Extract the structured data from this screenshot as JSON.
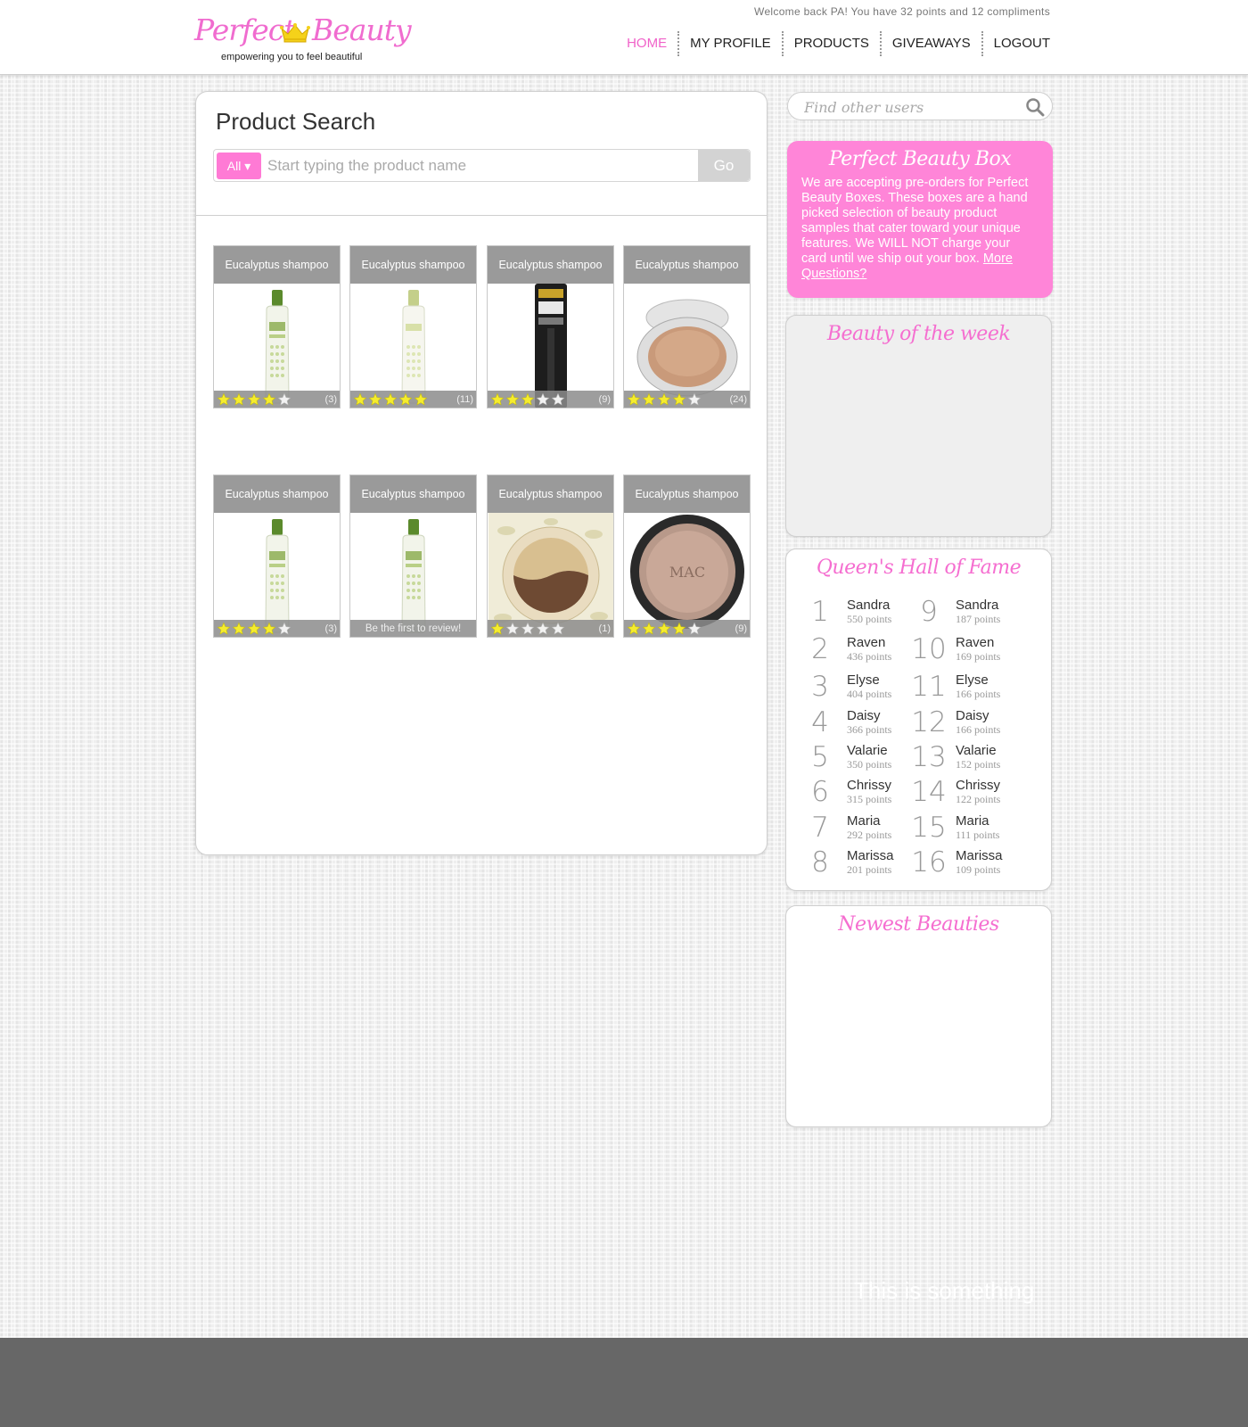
{
  "header": {
    "logo_word1": "Perfect",
    "logo_word2": "Beauty",
    "tagline": "empowering you to feel beautiful",
    "welcome": "Welcome back PA! You have 32 points and 12 compliments",
    "nav": [
      {
        "label": "HOME",
        "active": true
      },
      {
        "label": "MY PROFILE",
        "active": false
      },
      {
        "label": "PRODUCTS",
        "active": false
      },
      {
        "label": "GIVEAWAYS",
        "active": false
      },
      {
        "label": "LOGOUT",
        "active": false
      }
    ]
  },
  "product_search": {
    "title": "Product Search",
    "filter_label": "All ▾",
    "placeholder": "Start typing the product name",
    "go_label": "Go"
  },
  "products": [
    {
      "title": "Eucalyptus shampoo",
      "image": "shampoo-bottle",
      "rating": 4,
      "count": "(3)"
    },
    {
      "title": "Eucalyptus shampoo",
      "image": "shampoo-bottle-light",
      "rating": 5,
      "count": "(11)"
    },
    {
      "title": "Eucalyptus shampoo",
      "image": "mascara",
      "rating": 3,
      "count": "(9)"
    },
    {
      "title": "Eucalyptus shampoo",
      "image": "compact-powder",
      "rating": 4,
      "count": "(24)"
    },
    {
      "title": "Eucalyptus shampoo",
      "image": "shampoo-bottle",
      "rating": 4,
      "count": "(3)"
    },
    {
      "title": "Eucalyptus shampoo",
      "image": "shampoo-bottle",
      "rating": 0,
      "count": "",
      "no_review_text": "Be the first to review!"
    },
    {
      "title": "Eucalyptus shampoo",
      "image": "eyeshadow-duo",
      "rating": 1,
      "count": "(1)"
    },
    {
      "title": "Eucalyptus shampoo",
      "image": "mac-compact",
      "rating": 4,
      "count": "(9)"
    }
  ],
  "sidebar": {
    "user_search_placeholder": "Find other users",
    "promo": {
      "title": "Perfect Beauty Box",
      "text": "We are accepting pre-orders for Perfect Beauty Boxes. These boxes are a hand picked selection of beauty product samples that cater toward your unique features. We WILL NOT charge your card until we ship out your box. ",
      "link": "More Questions?"
    },
    "beauty_week_title": "Beauty of the week",
    "hall_of_fame_title": "Queen's Hall of Fame",
    "hall_of_fame": [
      {
        "rank": "1",
        "name": "Sandra",
        "points": "550 points"
      },
      {
        "rank": "2",
        "name": "Raven",
        "points": "436 points"
      },
      {
        "rank": "3",
        "name": "Elyse",
        "points": "404 points"
      },
      {
        "rank": "4",
        "name": "Daisy",
        "points": "366 points"
      },
      {
        "rank": "5",
        "name": "Valarie",
        "points": "350 points"
      },
      {
        "rank": "6",
        "name": "Chrissy",
        "points": "315 points"
      },
      {
        "rank": "7",
        "name": "Maria",
        "points": "292 points"
      },
      {
        "rank": "8",
        "name": "Marissa",
        "points": "201 points"
      },
      {
        "rank": "9",
        "name": "Sandra",
        "points": "187 points"
      },
      {
        "rank": "10",
        "name": "Raven",
        "points": "169 points"
      },
      {
        "rank": "11",
        "name": "Elyse",
        "points": "166 points"
      },
      {
        "rank": "12",
        "name": "Daisy",
        "points": "166 points"
      },
      {
        "rank": "13",
        "name": "Valarie",
        "points": "152 points"
      },
      {
        "rank": "14",
        "name": "Chrissy",
        "points": "122 points"
      },
      {
        "rank": "15",
        "name": "Maria",
        "points": "111 points"
      },
      {
        "rank": "16",
        "name": "Marissa",
        "points": "109 points"
      }
    ],
    "newest_title": "Newest Beauties"
  },
  "footer": {
    "text": "This is something"
  },
  "colors": {
    "brand_pink": "#f06ccf",
    "promo_pink": "#ff85d8",
    "star_yellow": "#f5ec2e",
    "footer_gray": "#676767"
  }
}
